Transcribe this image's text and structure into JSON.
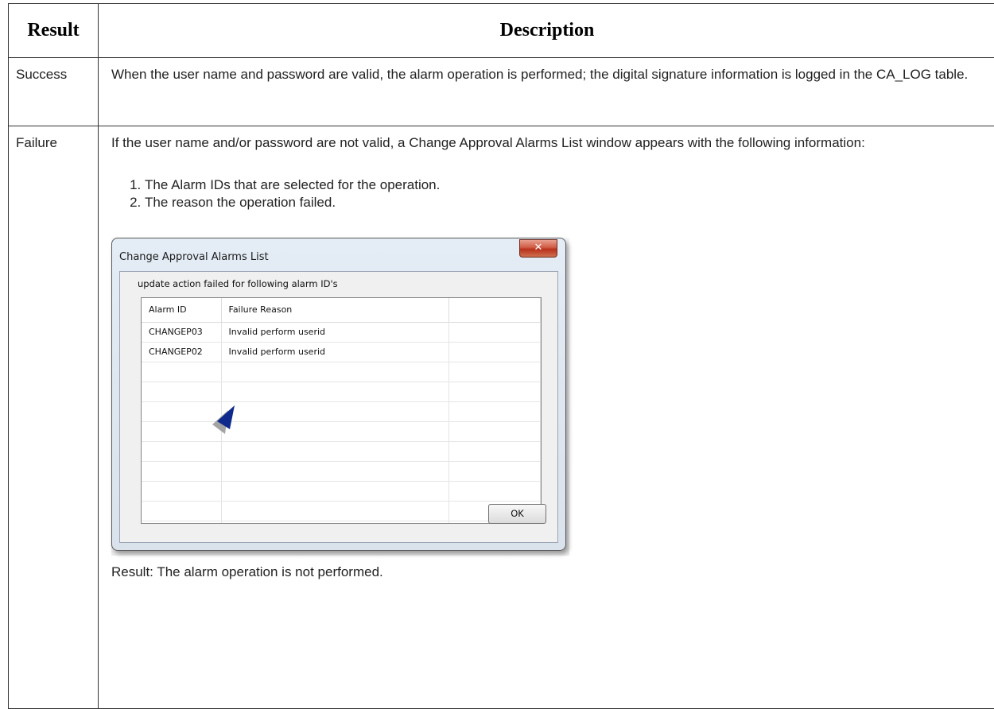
{
  "table": {
    "headers": [
      "Result",
      "Description"
    ],
    "success": {
      "result": "Success",
      "description": "When the user name and password are valid, the alarm operation is performed; the digital signature information is logged in the CA_LOG table."
    },
    "failure": {
      "result": "Failure",
      "intro": "If the user name and/or password are not valid, a Change Approval Alarms List window appears with the following information:",
      "steps": [
        "The Alarm IDs that are selected  for the operation.",
        "The reason the operation failed."
      ],
      "result_note": "Result: The alarm operation is not performed."
    }
  },
  "dialog": {
    "title": "Change Approval Alarms List",
    "close_glyph": "✕",
    "message": "update action failed for following alarm ID's",
    "columns": [
      "Alarm ID",
      "Failure Reason"
    ],
    "rows": [
      {
        "id": "CHANGEP03",
        "reason": "Invalid perform userid"
      },
      {
        "id": "CHANGEP02",
        "reason": "Invalid perform userid"
      }
    ],
    "ok_label": "OK",
    "pointer_icon": "arrow-pointer-icon",
    "colors": {
      "pointer": "#0f2a8c",
      "close_button": "#c4412a"
    }
  }
}
